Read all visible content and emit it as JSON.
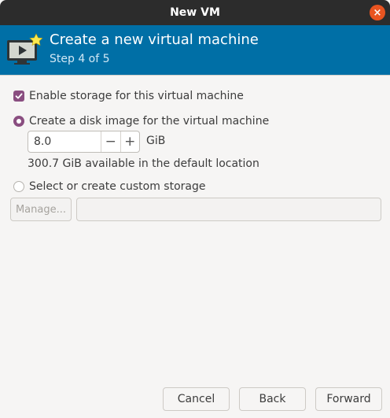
{
  "window": {
    "title": "New VM",
    "close_glyph": "×"
  },
  "header": {
    "title": "Create a new virtual machine",
    "step": "Step 4 of 5",
    "icon": "virtual-machine-new-icon",
    "accent_color": "#006fa6"
  },
  "storage": {
    "enable_label": "Enable storage for this virtual machine",
    "enable_checked": true,
    "disk_image_label": "Create a disk image for the virtual machine",
    "disk_image_selected": true,
    "size_value": "8.0",
    "size_unit": "GiB",
    "minus_glyph": "−",
    "plus_glyph": "+",
    "available_text": "300.7 GiB available in the default location",
    "custom_label": "Select or create custom storage",
    "custom_selected": false,
    "manage_label": "Manage...",
    "custom_path_value": ""
  },
  "footer": {
    "cancel_label": "Cancel",
    "back_label": "Back",
    "forward_label": "Forward"
  }
}
